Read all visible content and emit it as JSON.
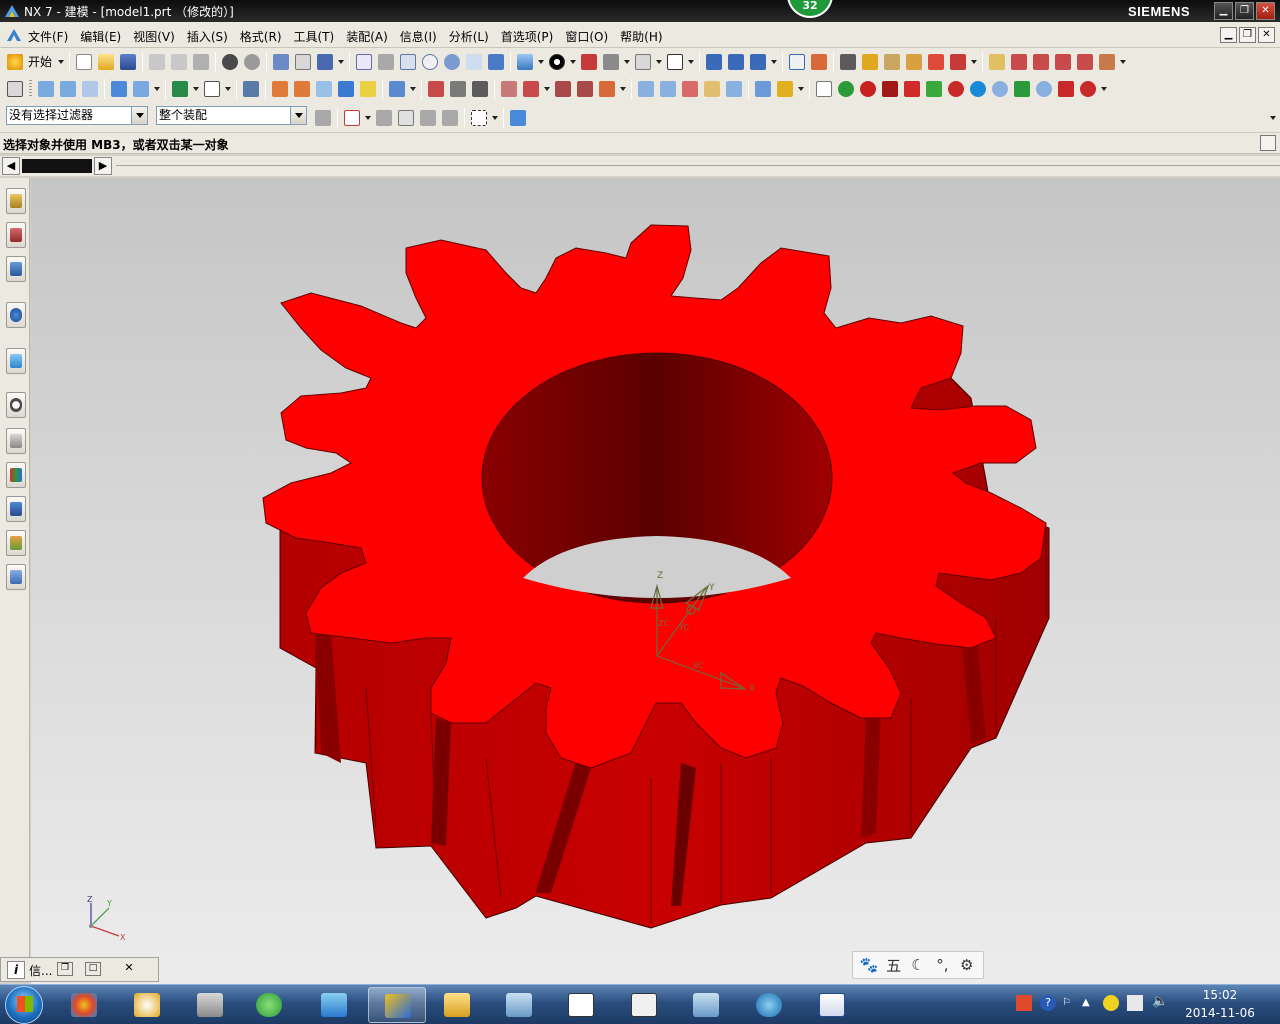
{
  "window": {
    "title": "NX 7 - 建模 - [model1.prt （修改的）]",
    "badge": "32",
    "brand": "SIEMENS",
    "controls": [
      "minimize",
      "maximize",
      "close"
    ]
  },
  "menu": {
    "items": [
      "文件(F)",
      "编辑(E)",
      "视图(V)",
      "插入(S)",
      "格式(R)",
      "工具(T)",
      "装配(A)",
      "信息(I)",
      "分析(L)",
      "首选项(P)",
      "窗口(O)",
      "帮助(H)"
    ]
  },
  "toolbar": {
    "start_label": "开始",
    "selection_filter": "没有选择过滤器",
    "selection_scope": "整个装配"
  },
  "cue_line": "选择对象并使用 MB3，或者双击某一对象",
  "info_window": {
    "label": "信..."
  },
  "ime_bar": {
    "items": [
      "paw-icon",
      "五",
      "moon-icon",
      "dots-icon",
      "gear-icon"
    ]
  },
  "taskbar": {
    "time": "15:02",
    "date": "2014-11-06"
  },
  "colors": {
    "gear_face": "#ff0000",
    "gear_side": "#c00000",
    "gear_side_dark": "#7a0000",
    "viewport_top": "#c5c5c5",
    "viewport_bottom": "#ececec",
    "csys": "#6b6a3e"
  }
}
